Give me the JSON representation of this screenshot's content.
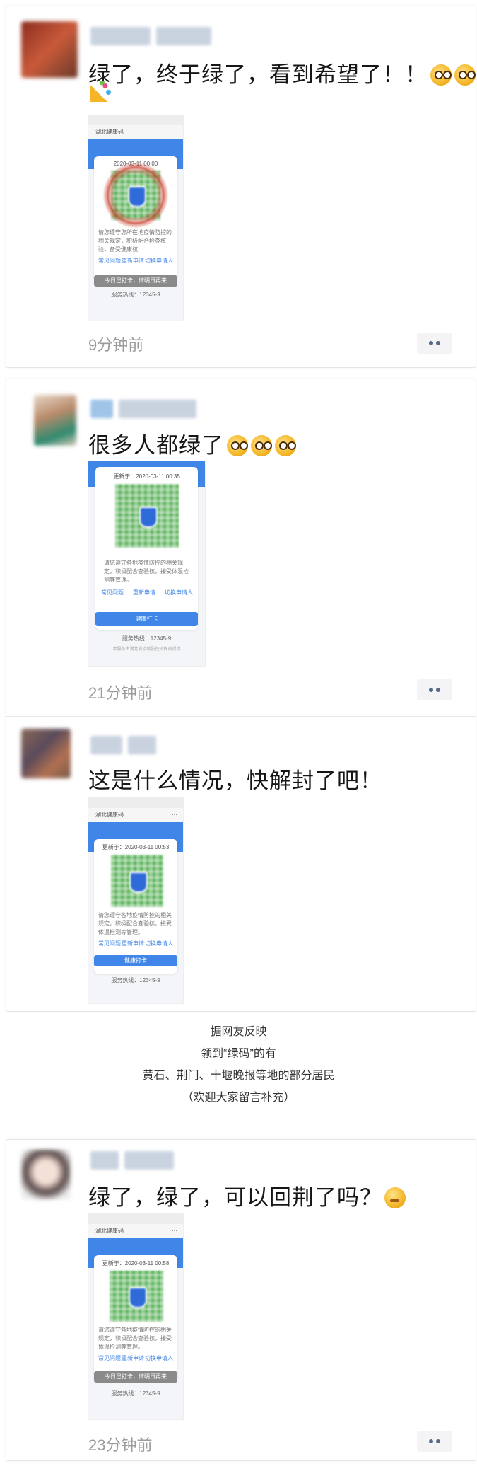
{
  "posts": [
    {
      "text": "绿了，终于绿了，看到希望了！！",
      "time": "9分钟前",
      "shot": {
        "app_title": "湖北健康码",
        "date": "2020-03-11 00:00",
        "note": "请您遵守您所在地疫情防控的相关规定，积极配合检查核验，备受健康权",
        "links": [
          "常见问题",
          "重新申请",
          "切换申请人"
        ],
        "button": "今日已打卡，请明日再来",
        "hotline": "服务热线：12345-9"
      }
    },
    {
      "text": "很多人都绿了",
      "time": "21分钟前",
      "shot": {
        "date": "更新于：2020-03-11 00:35",
        "note": "请您遵守各地疫情防控的相关规定，积极配合查验核，接受体温检测等管理。",
        "links": [
          "常见问题",
          "重新申请",
          "切换申请人"
        ],
        "button": "健康打卡",
        "hotline": "服务热线：12345-9",
        "fine": "本服务由湖北省疫情防控指挥部提供"
      }
    },
    {
      "text": "这是什么情况，快解封了吧！",
      "shot": {
        "app_title": "湖北健康码",
        "date": "更新于：2020-03-11 00:53",
        "note": "请您遵守各地疫情防控的相关规定，积极配合查验核，接受体温检测等管理。",
        "links": [
          "常见问题",
          "重新申请",
          "切换申请人"
        ],
        "button": "健康打卡",
        "hotline": "服务热线：12345-9"
      }
    },
    {
      "text": "绿了，绿了，可以回荆了吗？",
      "time": "23分钟前",
      "shot": {
        "app_title": "湖北健康码",
        "date": "更新于：2020-03-11 00:58",
        "note": "请您遵守各地疫情防控的相关规定，积极配合查验核，接受体温检测等管理。",
        "links": [
          "常见问题",
          "重新申请",
          "切换申请人"
        ],
        "button": "今日已打卡，请明日再来",
        "hotline": "服务热线：12345-9"
      }
    }
  ],
  "caption": {
    "line1": "据网友反映",
    "line2": "领到“绿码”的有",
    "line3": "黄石、荆门、十堰晚报等地的部分居民",
    "line4": "（欢迎大家留言补充）"
  },
  "colors": {
    "accent": "#3f86e8",
    "qr_green": "#5cb35c",
    "text": "#161616",
    "muted": "#9b9b9b"
  }
}
